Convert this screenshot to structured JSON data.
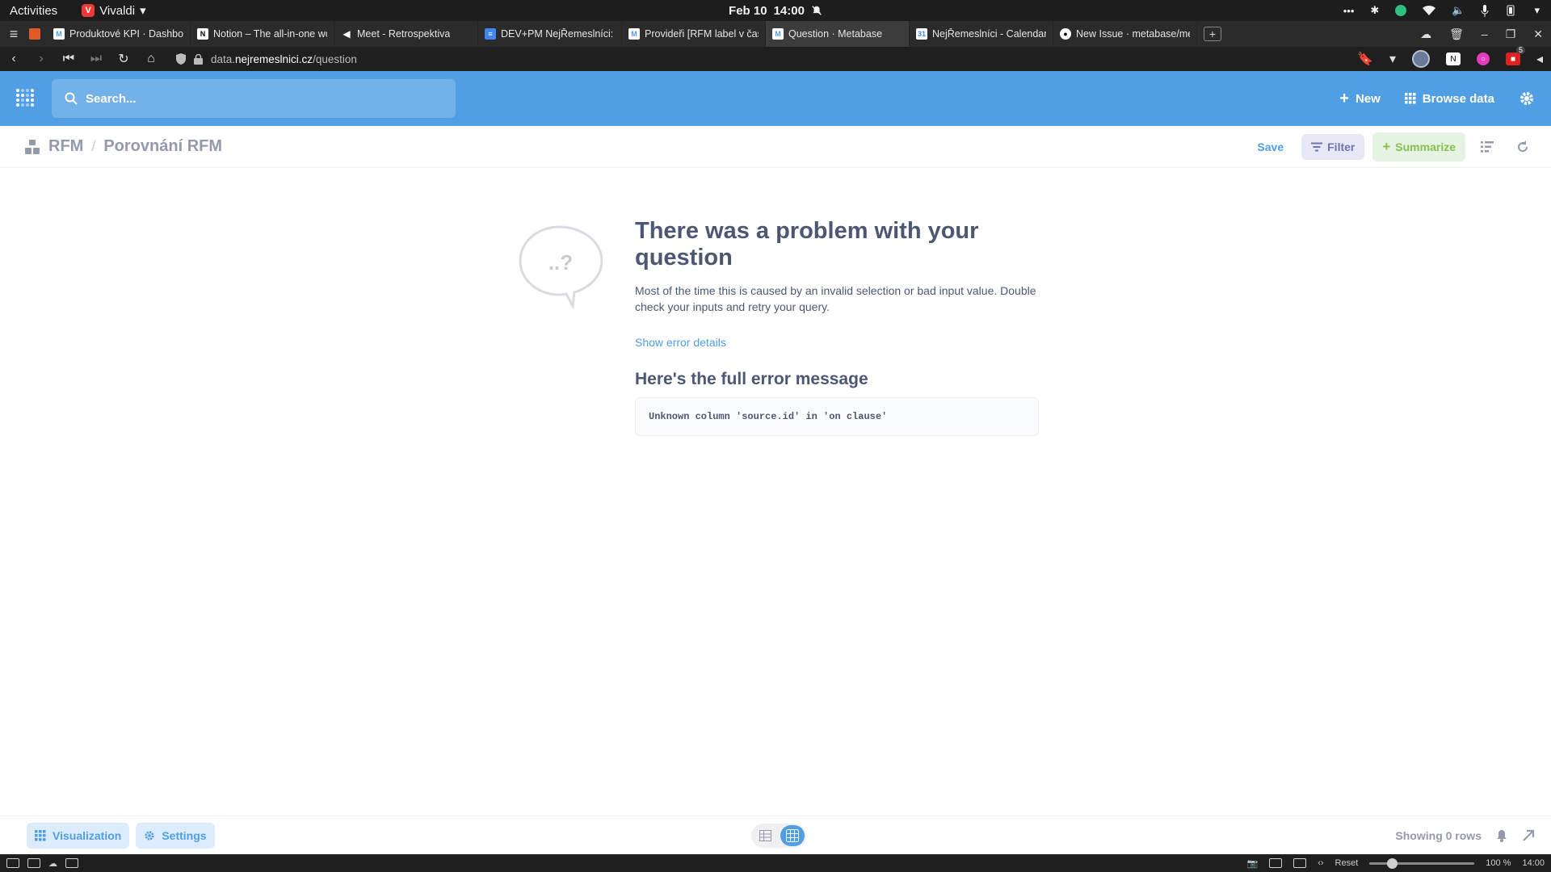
{
  "os_bar": {
    "activities": "Activities",
    "app_name": "Vivaldi",
    "date": "Feb 10",
    "time": "14:00"
  },
  "tabs": [
    {
      "label": "Produktové KPI · Dashboar",
      "icon": "metabase",
      "icon_color": "#ffffff"
    },
    {
      "label": "Notion – The all-in-one wor",
      "icon": "notion",
      "icon_color": "#ffffff"
    },
    {
      "label": "Meet - Retrospektiva",
      "icon": "speaker",
      "icon_color": "#ffffff"
    },
    {
      "label": "DEV+PM NejŘemeslníci: Re",
      "icon": "docs",
      "icon_color": "#4285f4"
    },
    {
      "label": "Provideři [RFM label v čase",
      "icon": "metabase",
      "icon_color": "#ffffff"
    },
    {
      "label": "Question · Metabase",
      "icon": "metabase",
      "icon_color": "#ffffff",
      "active": true
    },
    {
      "label": "NejŘemeslníci - Calendar -",
      "icon": "calendar",
      "icon_color": "#4285f4"
    },
    {
      "label": "New Issue · metabase/met",
      "icon": "github",
      "icon_color": "#ffffff"
    }
  ],
  "address": {
    "prefix": "data.",
    "domain": "nejremeslnici.cz",
    "path": "/question",
    "extension_badge": "5"
  },
  "nav": {
    "search_placeholder": "Search...",
    "new_label": "New",
    "browse_label": "Browse data"
  },
  "breadcrumb": {
    "collection": "RFM",
    "question": "Porovnání RFM"
  },
  "actions": {
    "save": "Save",
    "filter": "Filter",
    "summarize": "Summarize"
  },
  "error": {
    "bubble_text": "..?",
    "title": "There was a problem with your question",
    "description": "Most of the time this is caused by an invalid selection or bad input value. Double check your inputs and retry your query.",
    "details_link": "Show error details",
    "subtitle": "Here's the full error message",
    "message": "Unknown column 'source.id' in 'on clause'"
  },
  "footer": {
    "visualization": "Visualization",
    "settings": "Settings",
    "row_count": "Showing 0 rows"
  },
  "statusbar": {
    "reset": "Reset",
    "zoom": "100 %",
    "time": "14:00"
  },
  "colors": {
    "brand": "#509ee3",
    "filter": "#7172ad",
    "summarize": "#88bf4d",
    "text_dark": "#4c5773"
  }
}
